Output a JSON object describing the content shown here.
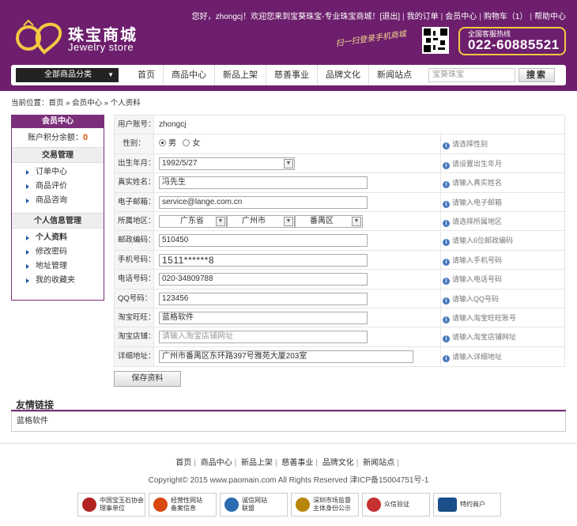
{
  "topbar": {
    "greeting": "您好，zhongcj！欢迎您来到宝葵珠宝-专业珠宝商城！[退出]",
    "my_orders": "我的订单",
    "member_center": "会员中心",
    "cart": "购物车（1）",
    "help": "帮助中心"
  },
  "logo": {
    "title": "珠宝商城",
    "subtitle": "Jewelry store"
  },
  "slogan": "扫一扫登录手机商城",
  "hotline": {
    "label": "全国客服热线",
    "number": "022-60885521"
  },
  "nav": {
    "category_button": "全部商品分类",
    "links": [
      "首页",
      "商品中心",
      "新品上架",
      "慈善事业",
      "品牌文化",
      "新闻站点"
    ],
    "search_placeholder": "宝葵珠宝",
    "search_button": "搜索"
  },
  "breadcrumb": "当前位置：首页 » 会员中心 » 个人资料",
  "sidebar": {
    "header": "会员中心",
    "points_label": "账户积分余额：",
    "points_value": "0",
    "sections": [
      {
        "title": "交易管理",
        "items": [
          "订单中心",
          "商品评价",
          "商品咨询"
        ]
      },
      {
        "title": "个人信息管理",
        "items": [
          "个人资料",
          "修改密码",
          "地址管理",
          "我的收藏夹"
        ]
      }
    ]
  },
  "form": {
    "username_label": "用户账号：",
    "username_value": "zhongcj",
    "gender_label": "性别：",
    "gender_male": "男",
    "gender_female": "女",
    "gender_hint": "请选择性别",
    "birth_label": "出生年月：",
    "birth_value": "1992/5/27",
    "birth_hint": "请设置出生年月",
    "name_label": "真实姓名：",
    "name_value": "冯先生",
    "name_hint": "请输入真实姓名",
    "email_label": "电子邮箱：",
    "email_value": "service@lange.com.cn",
    "email_hint": "请输入电子邮箱",
    "region_label": "所属地区：",
    "province": "广东省",
    "city": "广州市",
    "district": "番禺区",
    "region_hint": "请选择所属地区",
    "zip_label": "邮政编码：",
    "zip_value": "510450",
    "zip_hint": "请输入6位邮政编码",
    "mobile_label": "手机号码：",
    "mobile_value": "1511******8",
    "mobile_hint": "请输入手机号码",
    "phone_label": "电话号码：",
    "phone_value": "020-34809788",
    "phone_hint": "请输入电话号码",
    "qq_label": "QQ号码：",
    "qq_value": "123456",
    "qq_hint": "请输入QQ号码",
    "wangwang_label": "淘宝旺旺：",
    "wangwang_value": "蓝格软件",
    "wangwang_hint": "请输入淘宝旺旺账号",
    "shop_label": "淘宝店铺：",
    "shop_placeholder": "请输入淘宝店铺网址",
    "shop_hint": "请输入淘宝店铺网址",
    "address_label": "详细地址：",
    "address_value": "广州市番禺区东环路397号雅苑大厦203室",
    "address_hint": "请输入详细地址",
    "save_button": "保存资料"
  },
  "friend_links": {
    "title": "友情链接",
    "items": [
      "蓝格软件"
    ]
  },
  "footer": {
    "links": [
      "首页",
      "商品中心",
      "新品上架",
      "慈善事业",
      "品牌文化",
      "新闻站点"
    ],
    "copyright": "Copyright© 2015 www.paomain.com All Rights Reserved 津ICP备15004751号-1",
    "badges": [
      {
        "line1": "中国宝玉石协会",
        "line2": "理事单位",
        "color": "#b22222"
      },
      {
        "line1": "经营性网站",
        "line2": "备案信息",
        "color": "#d9480f"
      },
      {
        "line1": "诚信网站",
        "line2": "联盟",
        "color": "#2b6cb0"
      },
      {
        "line1": "深圳市场监督",
        "line2": "主体身份公示",
        "color": "#b8860b"
      },
      {
        "line1": "众信验证",
        "line2": "",
        "color": "#c53030"
      },
      {
        "line1": "特约商户",
        "line2": "",
        "color": "#1a4f8a"
      }
    ]
  },
  "colors": {
    "brand_purple": "#6d1f6d",
    "accent_gold": "#f4c842",
    "points_orange": "#d4500a"
  }
}
